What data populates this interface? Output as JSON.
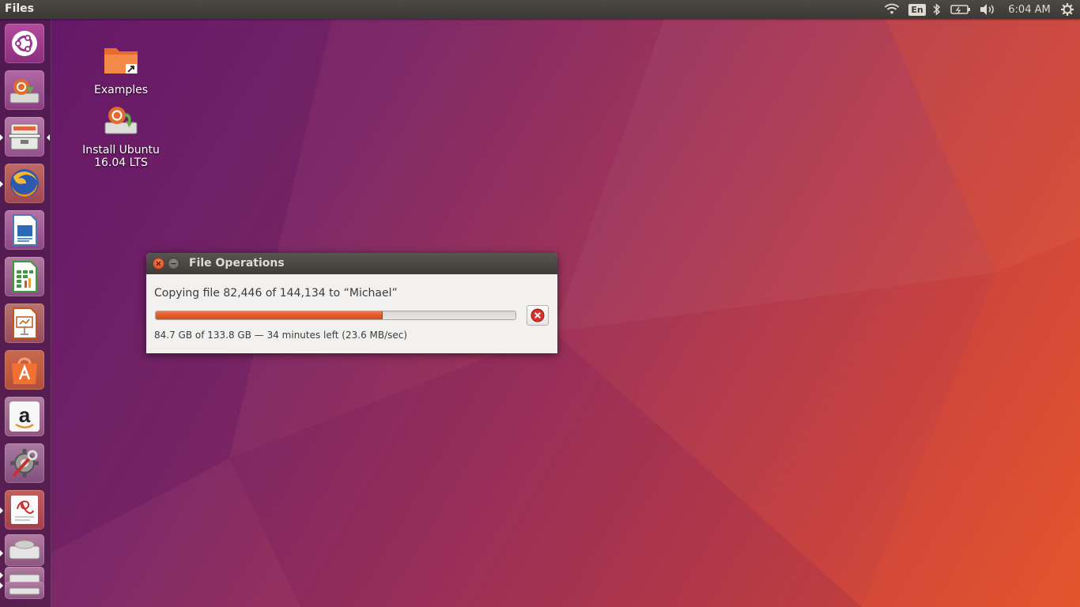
{
  "top_panel": {
    "app_title": "Files",
    "language": "En",
    "clock": "6:04 AM",
    "icons": [
      "wifi-icon",
      "bluetooth-icon",
      "battery-icon",
      "volume-icon",
      "system-gear-icon"
    ]
  },
  "launcher": {
    "items": [
      {
        "name": "dash-home-icon"
      },
      {
        "name": "install-ubuntu-icon"
      },
      {
        "name": "files-icon"
      },
      {
        "name": "firefox-icon"
      },
      {
        "name": "libreoffice-writer-icon"
      },
      {
        "name": "libreoffice-calc-icon"
      },
      {
        "name": "libreoffice-impress-icon"
      },
      {
        "name": "ubuntu-software-icon"
      },
      {
        "name": "amazon-icon"
      },
      {
        "name": "system-settings-icon"
      },
      {
        "name": "document-viewer-icon"
      },
      {
        "name": "disk-drive-icon"
      },
      {
        "name": "removable-drive-icon"
      }
    ]
  },
  "desktop": {
    "icons": [
      {
        "label": "Examples"
      },
      {
        "label_line1": "Install Ubuntu",
        "label_line2": "16.04 LTS"
      }
    ]
  },
  "dialog": {
    "title": "File Operations",
    "status": "Copying file 82,446 of 144,134 to “Michael”",
    "progress_fraction": 0.63,
    "details": "84.7 GB of 133.8 GB — 34 minutes left (23.6 MB/sec)"
  },
  "colors": {
    "accent": "#e05a2a",
    "panel": "#3b3a36",
    "dialog_bg": "#f2f1f0",
    "cancel_red": "#d8332b"
  }
}
